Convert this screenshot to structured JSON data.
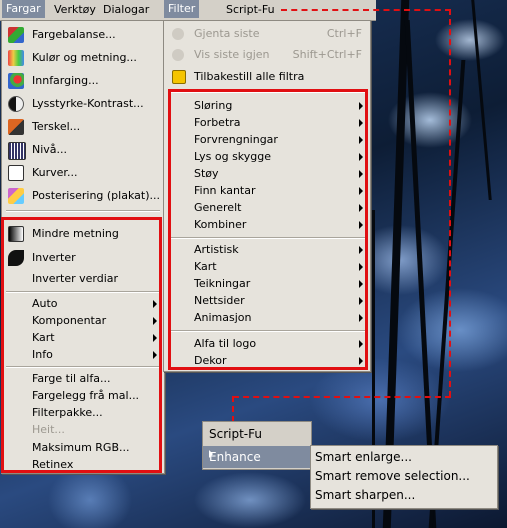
{
  "menubar": {
    "items": [
      {
        "label": "Fargar",
        "state": "active"
      },
      {
        "label": "Verktøy"
      },
      {
        "label": "Dialogar"
      },
      {
        "label": "Filter",
        "state": "open"
      },
      {
        "label": "Script-Fu"
      }
    ]
  },
  "colors_menu": {
    "top_items": [
      {
        "label": "Fargebalanse...",
        "icon": "color-balance-icon"
      },
      {
        "label": "Kulør og metning...",
        "icon": "hue-saturation-icon"
      },
      {
        "label": "Innfarging...",
        "icon": "colorize-icon"
      },
      {
        "label": "Lysstyrke-Kontrast...",
        "icon": "brightness-contrast-icon"
      },
      {
        "label": "Terskel...",
        "icon": "threshold-icon"
      },
      {
        "label": "Nivå...",
        "icon": "levels-icon"
      },
      {
        "label": "Kurver...",
        "icon": "curves-icon"
      },
      {
        "label": "Posterisering (plakat)...",
        "icon": "posterize-icon"
      }
    ],
    "group1": [
      {
        "label": "Mindre metning",
        "icon": "desaturate-icon"
      },
      {
        "label": "Inverter",
        "icon": "invert-icon"
      },
      {
        "label": "Inverter verdiar"
      }
    ],
    "group2": [
      {
        "label": "Auto"
      },
      {
        "label": "Komponentar"
      },
      {
        "label": "Kart"
      },
      {
        "label": "Info"
      }
    ],
    "group3": [
      {
        "label": "Farge til alfa..."
      },
      {
        "label": "Fargelegg frå mal..."
      },
      {
        "label": "Filterpakke..."
      },
      {
        "label": "Heit...",
        "disabled": true
      },
      {
        "label": "Maksimum RGB..."
      },
      {
        "label": "Retinex"
      }
    ]
  },
  "filter_menu": {
    "top_items": [
      {
        "label": "Gjenta siste",
        "accel": "Ctrl+F",
        "disabled": true
      },
      {
        "label": "Vis siste igjen",
        "accel": "Shift+Ctrl+F",
        "disabled": true
      },
      {
        "label": "Tilbakestill alle filtra"
      }
    ],
    "group1": [
      "Sløring",
      "Forbetra",
      "Forvrengningar",
      "Lys og skygge",
      "Støy",
      "Finn kantar",
      "Generelt",
      "Kombiner"
    ],
    "group2": [
      "Artistisk",
      "Kart",
      "Teikningar",
      "Nettsider",
      "Animasjon"
    ],
    "group3": [
      "Alfa til logo",
      "Dekor"
    ]
  },
  "scriptfu_popup": {
    "title": "Script-Fu",
    "item": "Enhance"
  },
  "enhance_menu": {
    "items": [
      "Smart enlarge...",
      "Smart remove selection...",
      "Smart sharpen..."
    ]
  },
  "colors": {
    "highlight": "#7f8b9f",
    "menu_bg": "#e6e3dc",
    "annotation_red": "#e10f12"
  }
}
